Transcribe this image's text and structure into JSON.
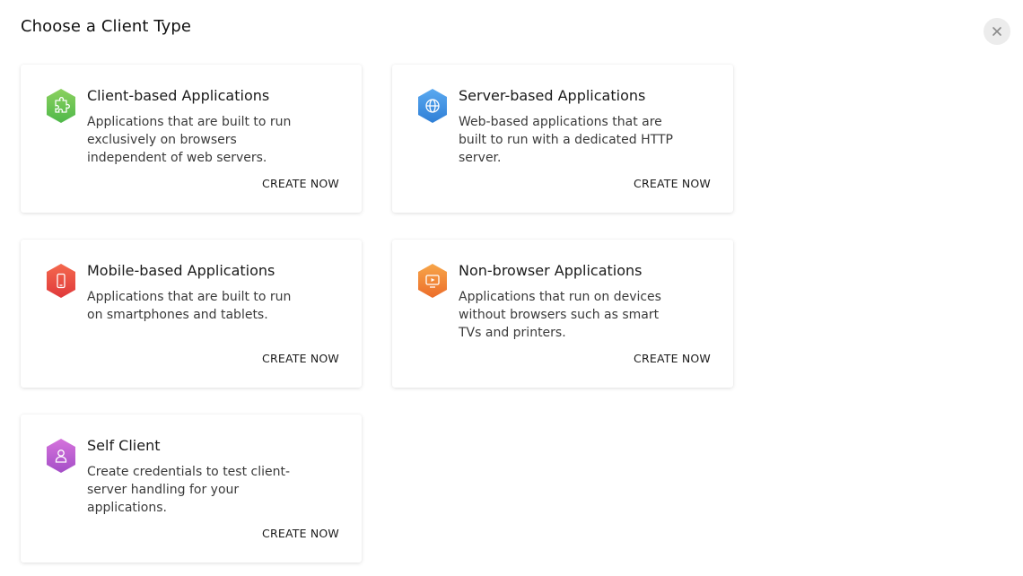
{
  "dialog": {
    "title": "Choose a Client Type",
    "close_icon": "close-icon"
  },
  "cards": [
    {
      "title": "Client-based Applications",
      "description": "Applications that are built to run exclusively on browsers independent of web servers.",
      "action": "CREATE NOW",
      "icon": "puzzle-icon",
      "color_top": "#8bd15f",
      "color_bottom": "#4fb84a"
    },
    {
      "title": "Server-based Applications",
      "description": "Web-based applications that are built to run with a dedicated HTTP server.",
      "action": "CREATE NOW",
      "icon": "globe-icon",
      "color_top": "#5aa9f0",
      "color_bottom": "#2f7fd6"
    },
    {
      "title": "Mobile-based Applications",
      "description": "Applications that are built to run on smartphones and tablets.",
      "action": "CREATE NOW",
      "icon": "mobile-icon",
      "color_top": "#f4694e",
      "color_bottom": "#e0393b"
    },
    {
      "title": "Non-browser Applications",
      "description": "Applications that run on devices without browsers such as smart TVs and printers.",
      "action": "CREATE NOW",
      "icon": "tv-icon",
      "color_top": "#f7a64a",
      "color_bottom": "#ec6d2a"
    },
    {
      "title": "Self Client",
      "description": "Create credentials to test client-server handling for your applications.",
      "action": "CREATE NOW",
      "icon": "user-icon",
      "color_top": "#d572dc",
      "color_bottom": "#a44fc7"
    }
  ]
}
